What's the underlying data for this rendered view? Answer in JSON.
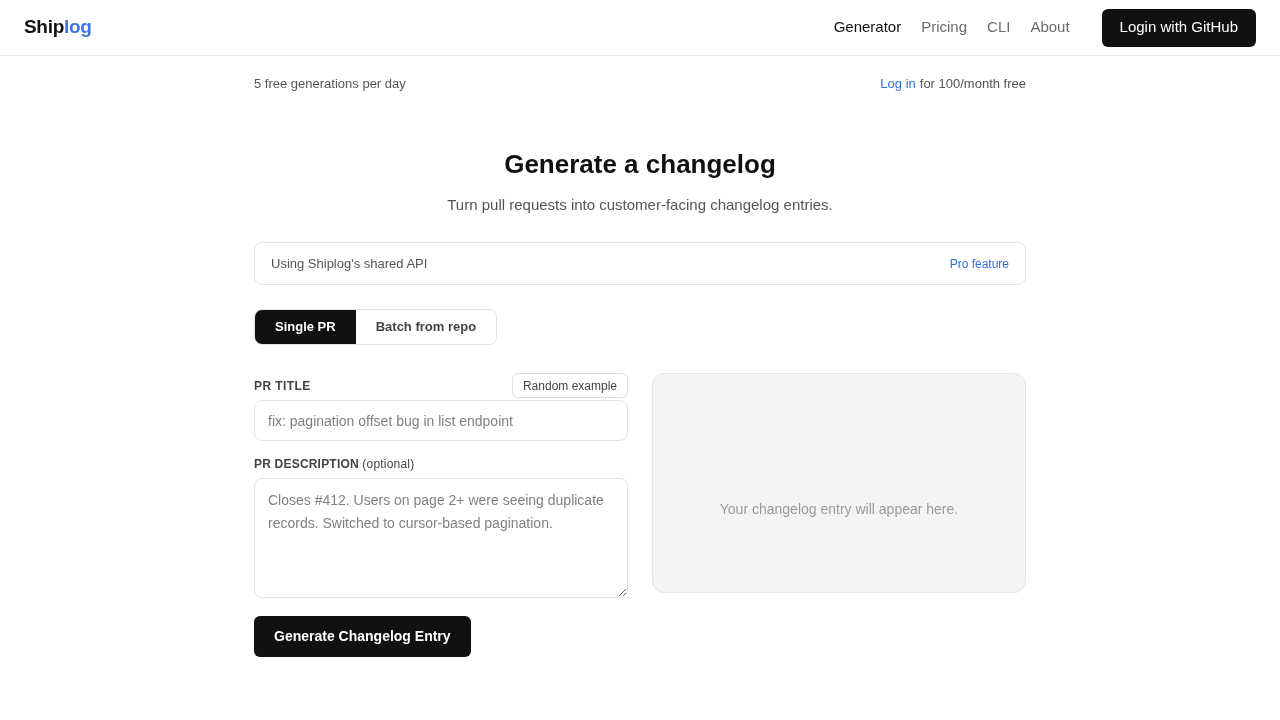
{
  "header": {
    "logo": [
      {
        "text": "Ship",
        "color": "#111111"
      },
      {
        "text": "log",
        "color": "#3b73e6"
      }
    ],
    "nav": [
      {
        "label": "Generator",
        "selected": true
      },
      {
        "label": "Pricing",
        "selected": false
      },
      {
        "label": "CLI",
        "selected": false
      },
      {
        "label": "About",
        "selected": false
      }
    ],
    "login_button": "Login with GitHub"
  },
  "quota_bar": {
    "left": "5 free generations per day",
    "link": "Log in",
    "right": "for 100/month free"
  },
  "hero": {
    "title": "Generate a changelog",
    "subtitle": "Turn pull requests into customer-facing changelog entries."
  },
  "api_notice": {
    "text": "Using Shiplog's shared API",
    "link": "Pro feature"
  },
  "tabs": [
    {
      "label": "Single PR",
      "selected": true
    },
    {
      "label": "Batch from repo",
      "selected": false
    }
  ],
  "form": {
    "title_label": "PR TITLE",
    "random_button": "Random example",
    "title_placeholder": "fix: pagination offset bug in list endpoint",
    "description_label": "**PR DESCRIPTION** (optional)",
    "description_placeholder": "Closes #412. Users on page 2+ were seeing duplicate records. Switched to cursor-based pagination.",
    "submit_button": "Generate Changelog Entry"
  },
  "output": {
    "placeholder": "Your changelog entry will appear here."
  }
}
